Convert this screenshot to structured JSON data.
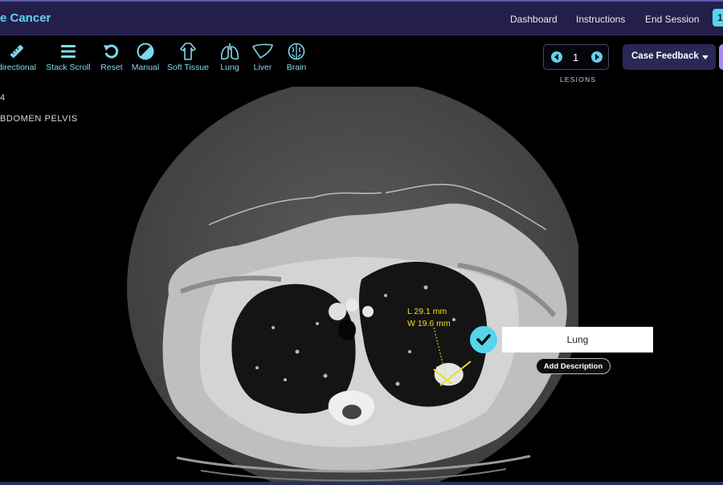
{
  "header": {
    "app_title": "e Cancer",
    "nav": [
      "Dashboard",
      "Instructions",
      "End Session"
    ],
    "badge": "1",
    "accent": "#5fd4ee"
  },
  "toolbar": {
    "tools": [
      {
        "label": "directional",
        "icon": "ruler-pencil-icon"
      },
      {
        "label": "Stack Scroll",
        "icon": "stack-scroll-icon"
      },
      {
        "label": "Reset",
        "icon": "reset-icon"
      },
      {
        "label": "Manual",
        "icon": "contrast-icon"
      },
      {
        "label": "Soft Tissue",
        "icon": "body-icon"
      },
      {
        "label": "Lung",
        "icon": "lungs-icon"
      },
      {
        "label": "Liver",
        "icon": "liver-icon"
      },
      {
        "label": "Brain",
        "icon": "brain-icon"
      }
    ]
  },
  "lesions": {
    "count": "1",
    "caption": "LESIONS"
  },
  "feedback": {
    "label": "Case Feedback"
  },
  "series_info": {
    "line1": "4",
    "line2": "BDOMEN PELVIS"
  },
  "measurement": {
    "length": "L 29.1 mm",
    "width": "W 19.6 mm",
    "color": "#e8e01a"
  },
  "annotation": {
    "label": "Lung",
    "add_description": "Add Description"
  }
}
